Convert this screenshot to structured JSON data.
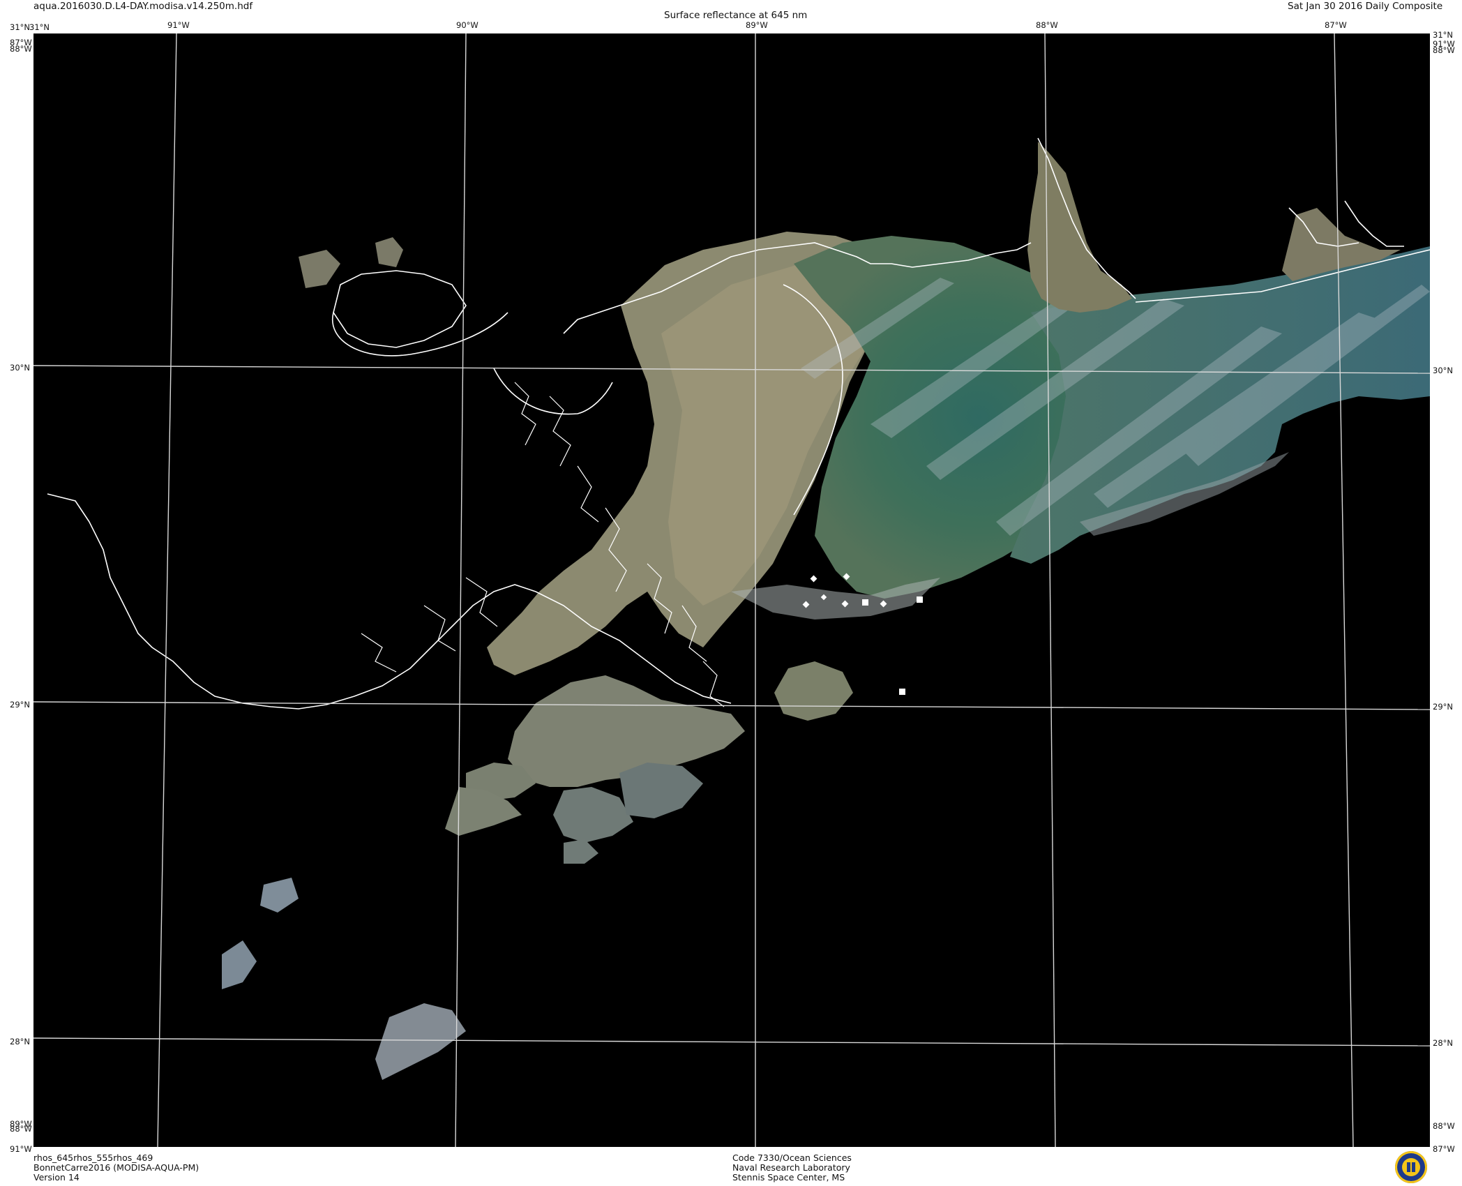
{
  "header": {
    "filename": "aqua.2016030.D.L4-DAY.modisa.v14.250m.hdf",
    "title": "Surface reflectance at 645 nm",
    "date": "Sat Jan 30 2016 Daily Composite"
  },
  "map": {
    "lon_labels": [
      "91°W",
      "90°W",
      "89°W",
      "88°W",
      "87°W"
    ],
    "lat_labels": [
      "31°N",
      "30°N",
      "29°N",
      "28°N"
    ],
    "corner_labels": {
      "top_left_a": "31°N",
      "top_left_b": "87°W",
      "top_left_c": "88°W",
      "top_right_a": "31°N",
      "top_right_b": "91°W",
      "top_right_c": "88°W",
      "bottom_left_a": "89°W",
      "bottom_left_b": "88°W",
      "bottom_left_c": "91°W",
      "bottom_right_a": "88°W",
      "bottom_right_b": "87°W"
    },
    "colors": {
      "background": "#000000",
      "grid": "#d9d9d9",
      "coastline": "#ffffff",
      "sediment": "#8f8a6e",
      "teal_water": "#3f6e5e",
      "clouds": "#b9c3cc"
    },
    "station_markers": {
      "diamond_count": 6,
      "square_count": 3
    }
  },
  "footer": {
    "product_line1": "rhos_645rhos_555rhos_469",
    "product_line2": "BonnetCarre2016 (MODISA-AQUA-PM)",
    "product_line3": "Version 14",
    "org_line1": "Code 7330/Ocean Sciences",
    "org_line2": "Naval Research Laboratory",
    "org_line3": "Stennis Space Center, MS",
    "logo_icon": "nrl-seal-icon"
  }
}
